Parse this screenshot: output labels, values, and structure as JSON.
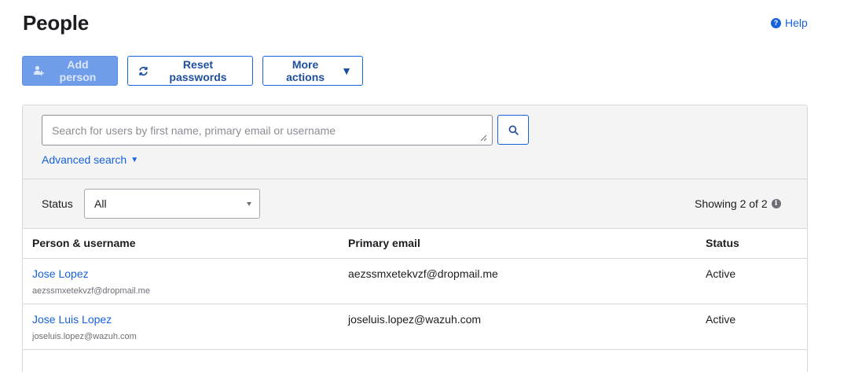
{
  "page": {
    "title": "People"
  },
  "help": {
    "label": "Help",
    "icon": "help-circle-icon"
  },
  "toolbar": {
    "add_person_label": "Add person",
    "reset_passwords_label": "Reset passwords",
    "more_actions_label": "More actions",
    "more_actions_caret": "▼"
  },
  "search": {
    "value": "",
    "placeholder": "Search for users by first name, primary email or username",
    "advanced_label": "Advanced search",
    "advanced_caret": "▼"
  },
  "filter": {
    "status_label": "Status",
    "status_selected": "All",
    "showing_text": "Showing 2 of 2"
  },
  "table": {
    "headers": {
      "person": "Person & username",
      "email": "Primary email",
      "status": "Status"
    },
    "rows": [
      {
        "name": "Jose Lopez",
        "username": "aezssmxetekvzf@dropmail.me",
        "email": "aezssmxetekvzf@dropmail.me",
        "status": "Active"
      },
      {
        "name": "Jose Luis Lopez",
        "username": "joseluis.lopez@wazuh.com",
        "email": "joseluis.lopez@wazuh.com",
        "status": "Active"
      }
    ]
  },
  "colors": {
    "accent": "#1662dd",
    "primary_disabled": "#6f9de9",
    "panel_bg": "#f4f4f4",
    "border": "#d7d7dc"
  }
}
